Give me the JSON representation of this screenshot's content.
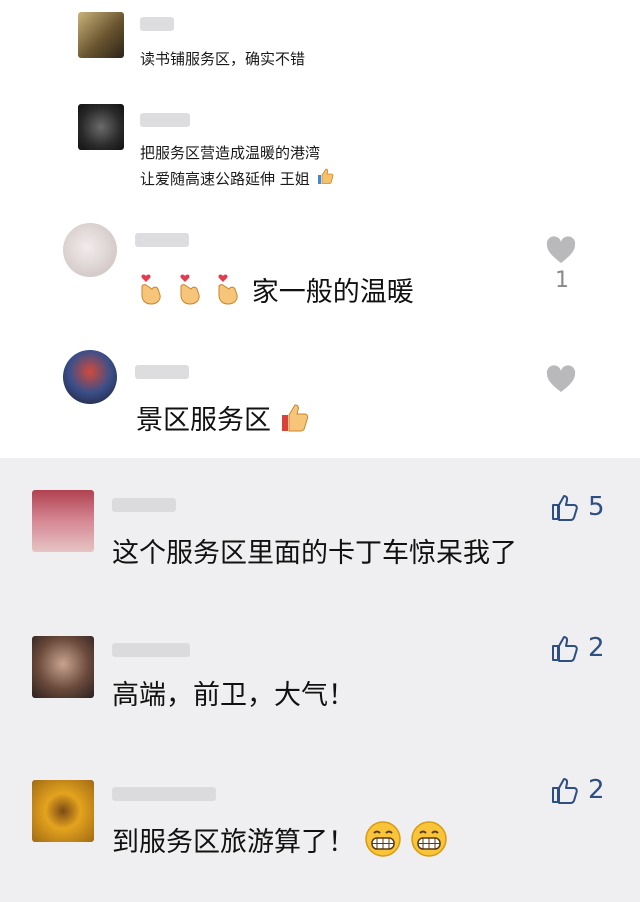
{
  "comments_top": [
    {
      "text": "读书铺服务区，确实不错"
    },
    {
      "text_line1": "把服务区营造成温暖的港湾",
      "text_line2": "让爱随高速公路延伸  王姐"
    },
    {
      "text": "家一般的温暖",
      "like_count": "1"
    },
    {
      "text": "景区服务区"
    }
  ],
  "comments_bottom": [
    {
      "text": "这个服务区里面的卡丁车惊呆我了",
      "like_count": "5"
    },
    {
      "text": "高端，前卫，大气！",
      "like_count": "2"
    },
    {
      "text": "到服务区旅游算了！",
      "like_count": "2"
    }
  ],
  "colors": {
    "like_blue": "#2f4e82",
    "heart_gray": "#b9b9bb",
    "bottom_bg": "#efeff1"
  },
  "icons": [
    "heart-icon",
    "thumbs-up-icon",
    "finger-heart-emoji",
    "grinning-emoji"
  ]
}
